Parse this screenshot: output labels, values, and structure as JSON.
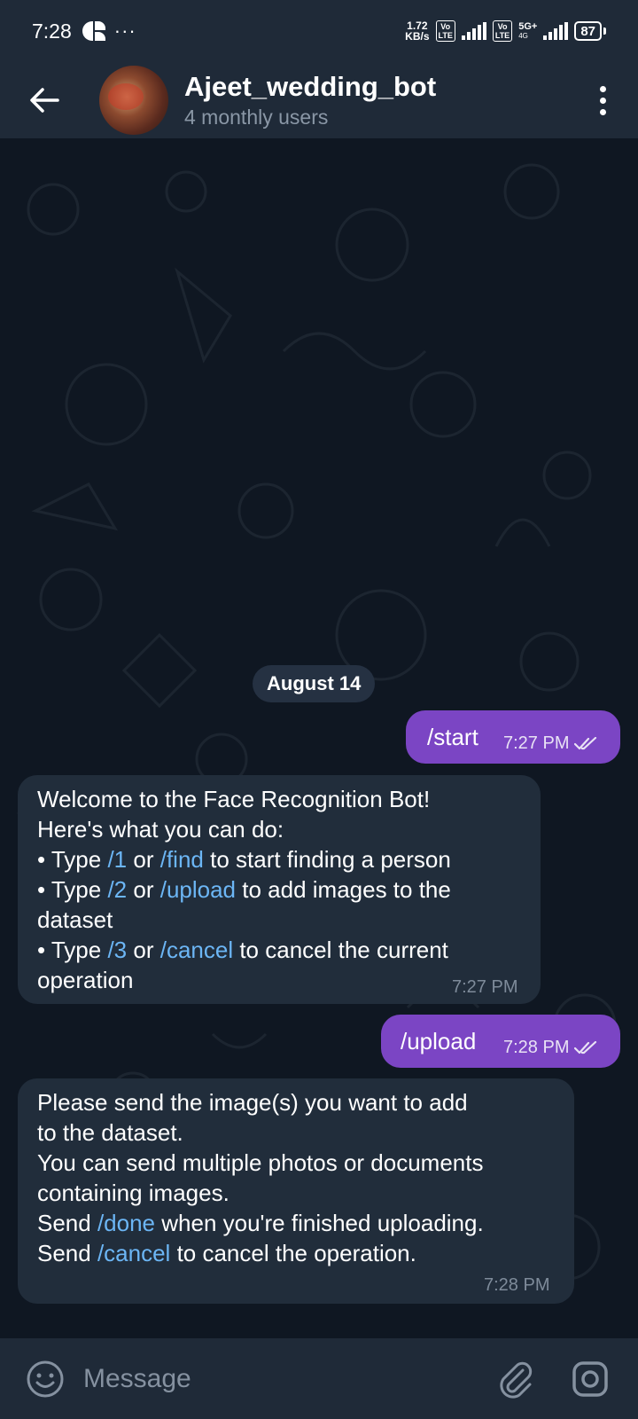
{
  "status_bar": {
    "time": "7:28",
    "dots": "···",
    "speed_value": "1.72",
    "speed_unit": "KB/s",
    "volte_top": "Vo",
    "volte_bottom": "LTE",
    "network": "5G+",
    "network_sub": "4G",
    "battery": "87"
  },
  "header": {
    "title": "Ajeet_wedding_bot",
    "subtitle": "4 monthly users"
  },
  "chat": {
    "date_label": "August 14",
    "messages": [
      {
        "direction": "out",
        "text": "/start",
        "time": "7:27 PM"
      },
      {
        "direction": "in",
        "time": "7:27 PM",
        "lines": [
          {
            "parts": [
              {
                "text": "Welcome to the Face Recognition Bot!"
              }
            ]
          },
          {
            "parts": [
              {
                "text": "Here's what you can do:"
              }
            ]
          },
          {
            "parts": [
              {
                "text": "• Type "
              },
              {
                "text": "/1",
                "cmd": true
              },
              {
                "text": " or "
              },
              {
                "text": "/find",
                "cmd": true
              },
              {
                "text": " to start finding a person"
              }
            ]
          },
          {
            "parts": [
              {
                "text": "• Type "
              },
              {
                "text": "/2",
                "cmd": true
              },
              {
                "text": " or "
              },
              {
                "text": "/upload",
                "cmd": true
              },
              {
                "text": " to add images to the"
              }
            ]
          },
          {
            "parts": [
              {
                "text": "dataset"
              }
            ]
          },
          {
            "parts": [
              {
                "text": "• Type "
              },
              {
                "text": "/3",
                "cmd": true
              },
              {
                "text": " or "
              },
              {
                "text": "/cancel",
                "cmd": true
              },
              {
                "text": " to cancel the current"
              }
            ]
          },
          {
            "parts": [
              {
                "text": "operation"
              }
            ]
          }
        ]
      },
      {
        "direction": "out",
        "text": "/upload",
        "time": "7:28 PM"
      },
      {
        "direction": "in",
        "time": "7:28 PM",
        "lines": [
          {
            "parts": [
              {
                "text": "Please send the image(s) you want to add"
              }
            ]
          },
          {
            "parts": [
              {
                "text": "to the dataset."
              }
            ]
          },
          {
            "parts": [
              {
                "text": "You can send multiple photos or documents"
              }
            ]
          },
          {
            "parts": [
              {
                "text": "containing images."
              }
            ]
          },
          {
            "parts": [
              {
                "text": "Send "
              },
              {
                "text": "/done",
                "cmd": true
              },
              {
                "text": " when you're finished uploading."
              }
            ]
          },
          {
            "parts": [
              {
                "text": "Send "
              },
              {
                "text": "/cancel",
                "cmd": true
              },
              {
                "text": " to cancel the operation."
              }
            ]
          }
        ]
      }
    ]
  },
  "input": {
    "placeholder": "Message"
  },
  "colors": {
    "header_bg": "#1f2a38",
    "chat_bg": "#0f1722",
    "outgoing_bubble": "#7b45c4",
    "incoming_bubble": "#212d3b",
    "command_link": "#6cb6f5",
    "muted_text": "#7e8b9a"
  },
  "icons": {
    "back": "arrow-left-icon",
    "menu": "more-vertical-icon",
    "read": "double-check-icon",
    "emoji": "smiley-icon",
    "attach": "paperclip-icon",
    "camera": "camera-icon"
  }
}
